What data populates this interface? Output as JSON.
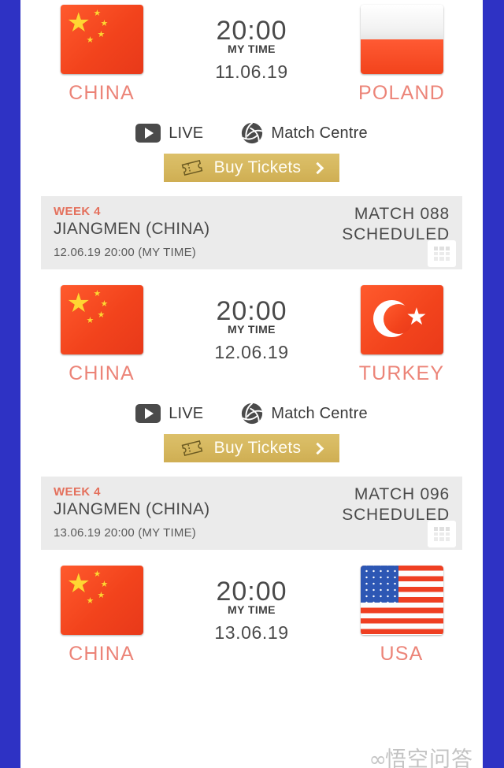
{
  "theme": {
    "page_background": "#2e32c4",
    "card_background": "#ffffff",
    "team_name_color": "#ec8478",
    "week_color": "#e4705c",
    "infobar_background": "#ebebeb",
    "tickets_button_color": "#d6b85f",
    "text_color": "#4a4a4a"
  },
  "matches": [
    {
      "home": {
        "name": "CHINA",
        "flag": "china-flag"
      },
      "away": {
        "name": "POLAND",
        "flag": "poland-flag"
      },
      "time": "20:00",
      "time_label": "MY TIME",
      "date": "11.06.19",
      "actions": {
        "live_label": "LIVE",
        "live_icon": "play-icon",
        "match_centre_label": "Match Centre",
        "match_centre_icon": "volleyball-icon",
        "tickets_label": "Buy Tickets",
        "tickets_icon": "ticket-icon",
        "tickets_chevron": "chevron-right-icon"
      }
    },
    {
      "home": {
        "name": "CHINA",
        "flag": "china-flag"
      },
      "away": {
        "name": "TURKEY",
        "flag": "turkey-flag"
      },
      "time": "20:00",
      "time_label": "MY TIME",
      "date": "12.06.19",
      "actions": {
        "live_label": "LIVE",
        "live_icon": "play-icon",
        "match_centre_label": "Match Centre",
        "match_centre_icon": "volleyball-icon",
        "tickets_label": "Buy Tickets",
        "tickets_icon": "ticket-icon",
        "tickets_chevron": "chevron-right-icon"
      }
    },
    {
      "home": {
        "name": "CHINA",
        "flag": "china-flag"
      },
      "away": {
        "name": "USA",
        "flag": "usa-flag"
      },
      "time": "20:00",
      "time_label": "MY TIME",
      "date": "13.06.19"
    }
  ],
  "infobars": [
    {
      "week": "WEEK 4",
      "venue": "JIANGMEN (CHINA)",
      "local_time": "12.06.19 20:00 (MY TIME)",
      "match_no": "MATCH 088",
      "status": "SCHEDULED",
      "calendar_icon": "calendar-icon"
    },
    {
      "week": "WEEK 4",
      "venue": "JIANGMEN (CHINA)",
      "local_time": "13.06.19 20:00 (MY TIME)",
      "match_no": "MATCH 096",
      "status": "SCHEDULED",
      "calendar_icon": "calendar-icon"
    }
  ],
  "watermark": {
    "logo": "∞",
    "text": "悟空问答"
  }
}
